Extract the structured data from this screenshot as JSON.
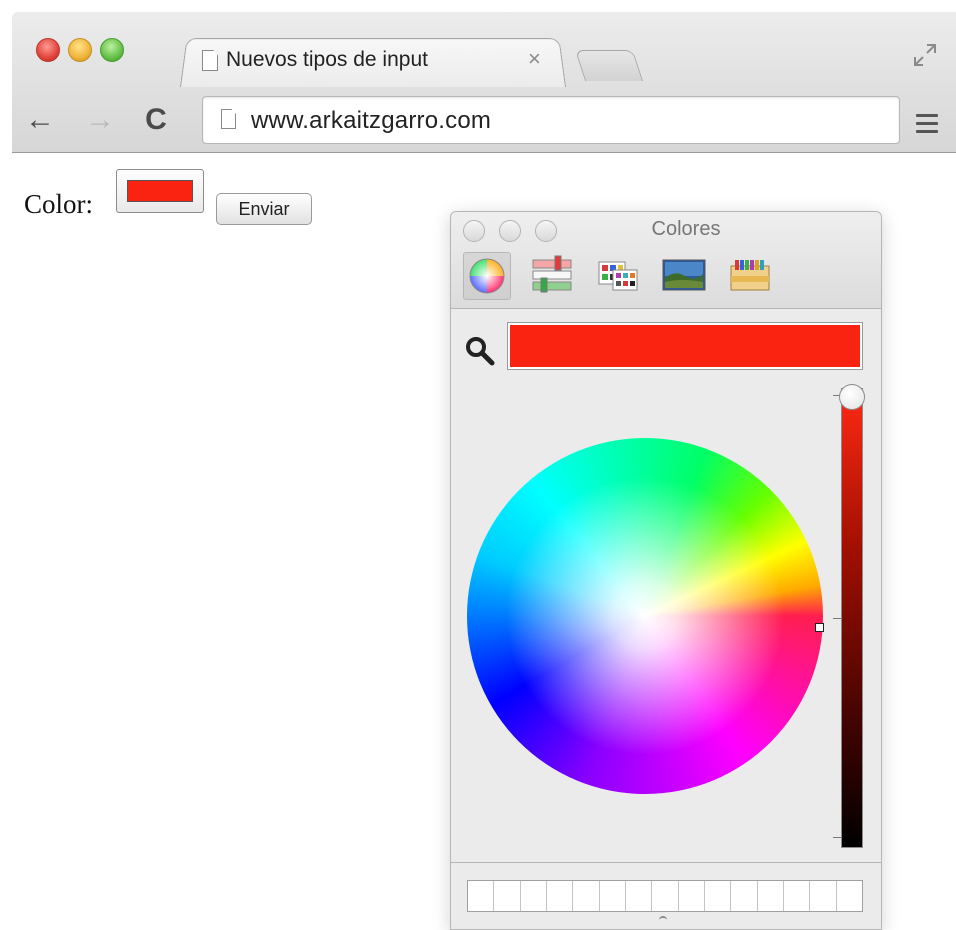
{
  "browser": {
    "tab": {
      "title": "Nuevos tipos de input",
      "close_glyph": "×"
    },
    "toolbar": {
      "back_glyph": "←",
      "forward_glyph": "→",
      "reload_glyph": "C",
      "url": "www.arkaitzgarro.com"
    }
  },
  "page": {
    "color_label": "Color:",
    "color_value": "#fa2312",
    "submit_label": "Enviar"
  },
  "color_panel": {
    "title": "Colores",
    "current_color": "#fa2312",
    "modes": [
      "color-wheel-icon",
      "color-sliders-icon",
      "color-palettes-icon",
      "image-palettes-icon",
      "crayons-icon"
    ],
    "active_mode": "color-wheel-icon",
    "brightness": 1.0,
    "swatch_count": 15
  },
  "colors": {
    "accent_red": "#fa2312",
    "chrome_bg": "#d6d6d6",
    "panel_bg": "#ebebeb"
  }
}
